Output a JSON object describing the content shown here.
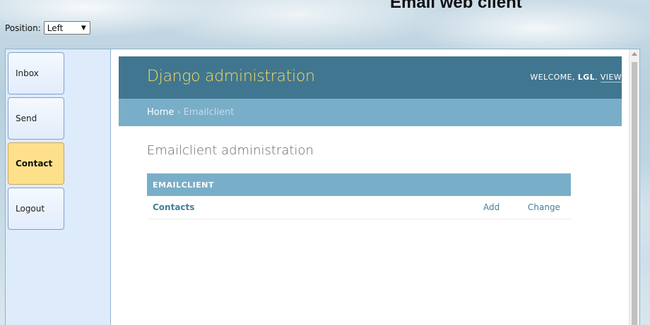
{
  "app": {
    "title": "Email web client"
  },
  "position": {
    "label": "Position:",
    "value": "Left"
  },
  "nav": {
    "items": [
      {
        "label": "Inbox",
        "active": false
      },
      {
        "label": "Send",
        "active": false
      },
      {
        "label": "Contact",
        "active": true
      },
      {
        "label": "Logout",
        "active": false
      }
    ]
  },
  "admin": {
    "branding": "Django administration",
    "user_tools": {
      "welcome": "WELCOME, ",
      "user": "LGL",
      "dot": ". ",
      "view_site": "VIEW"
    },
    "breadcrumbs": {
      "home": "Home",
      "separator": "›",
      "current": "Emailclient"
    },
    "page_heading": "Emailclient administration",
    "module": {
      "caption": "EMAILCLIENT",
      "rows": [
        {
          "model": "Contacts",
          "add": "Add",
          "change": "Change"
        }
      ]
    }
  },
  "colors": {
    "header_bg": "#417690",
    "branding": "#f5dd5d",
    "breadcrumb_bg": "#79aec8",
    "link": "#447e9b",
    "active_nav": "#ffe08a",
    "sidebar_bg": "#deebfb"
  }
}
